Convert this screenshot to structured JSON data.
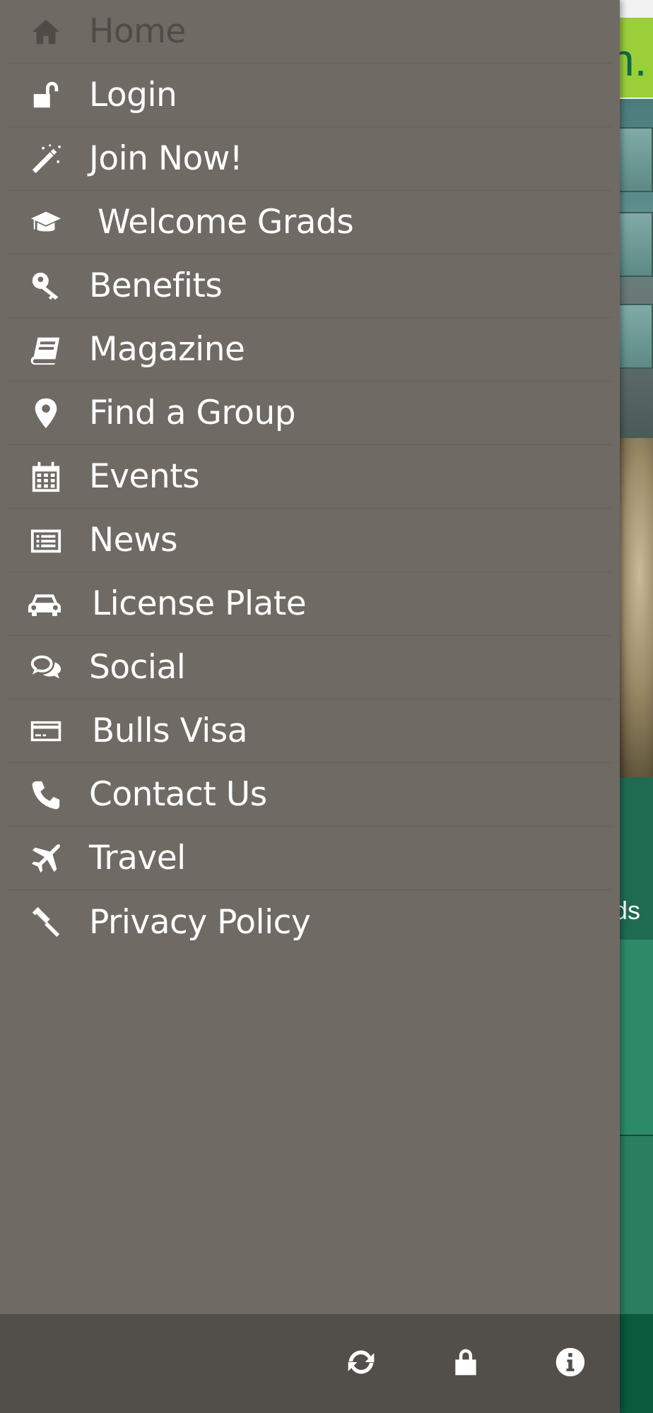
{
  "background_app": {
    "logo_letter_fragment": "n.",
    "partial_text": "ds"
  },
  "drawer": {
    "menu_items": [
      {
        "label": "Home",
        "icon": "home-icon",
        "active": true
      },
      {
        "label": "Login",
        "icon": "unlock-icon"
      },
      {
        "label": "Join Now!",
        "icon": "magic-wand-icon"
      },
      {
        "label": "Welcome Grads",
        "icon": "graduation-cap-icon"
      },
      {
        "label": "Benefits",
        "icon": "key-icon"
      },
      {
        "label": "Magazine",
        "icon": "book-icon"
      },
      {
        "label": "Find a Group",
        "icon": "map-marker-icon"
      },
      {
        "label": "Events",
        "icon": "calendar-icon"
      },
      {
        "label": "News",
        "icon": "newspaper-icon"
      },
      {
        "label": "License Plate",
        "icon": "car-icon"
      },
      {
        "label": "Social",
        "icon": "comments-icon"
      },
      {
        "label": "Bulls Visa",
        "icon": "credit-card-icon"
      },
      {
        "label": "Contact Us",
        "icon": "phone-icon"
      },
      {
        "label": "Travel",
        "icon": "plane-icon"
      },
      {
        "label": "Privacy Policy",
        "icon": "gavel-icon"
      }
    ],
    "toolbar": {
      "buttons": [
        {
          "icon": "refresh-icon"
        },
        {
          "icon": "lock-icon"
        },
        {
          "icon": "info-icon"
        }
      ]
    }
  },
  "colors": {
    "drawer_bg": "#6f6a64",
    "toolbar_bg": "#524f4b",
    "active_text": "#4f4b46",
    "text": "#ffffff",
    "accent_green": "#9bcf3a",
    "brand_green": "#1f6b52"
  }
}
